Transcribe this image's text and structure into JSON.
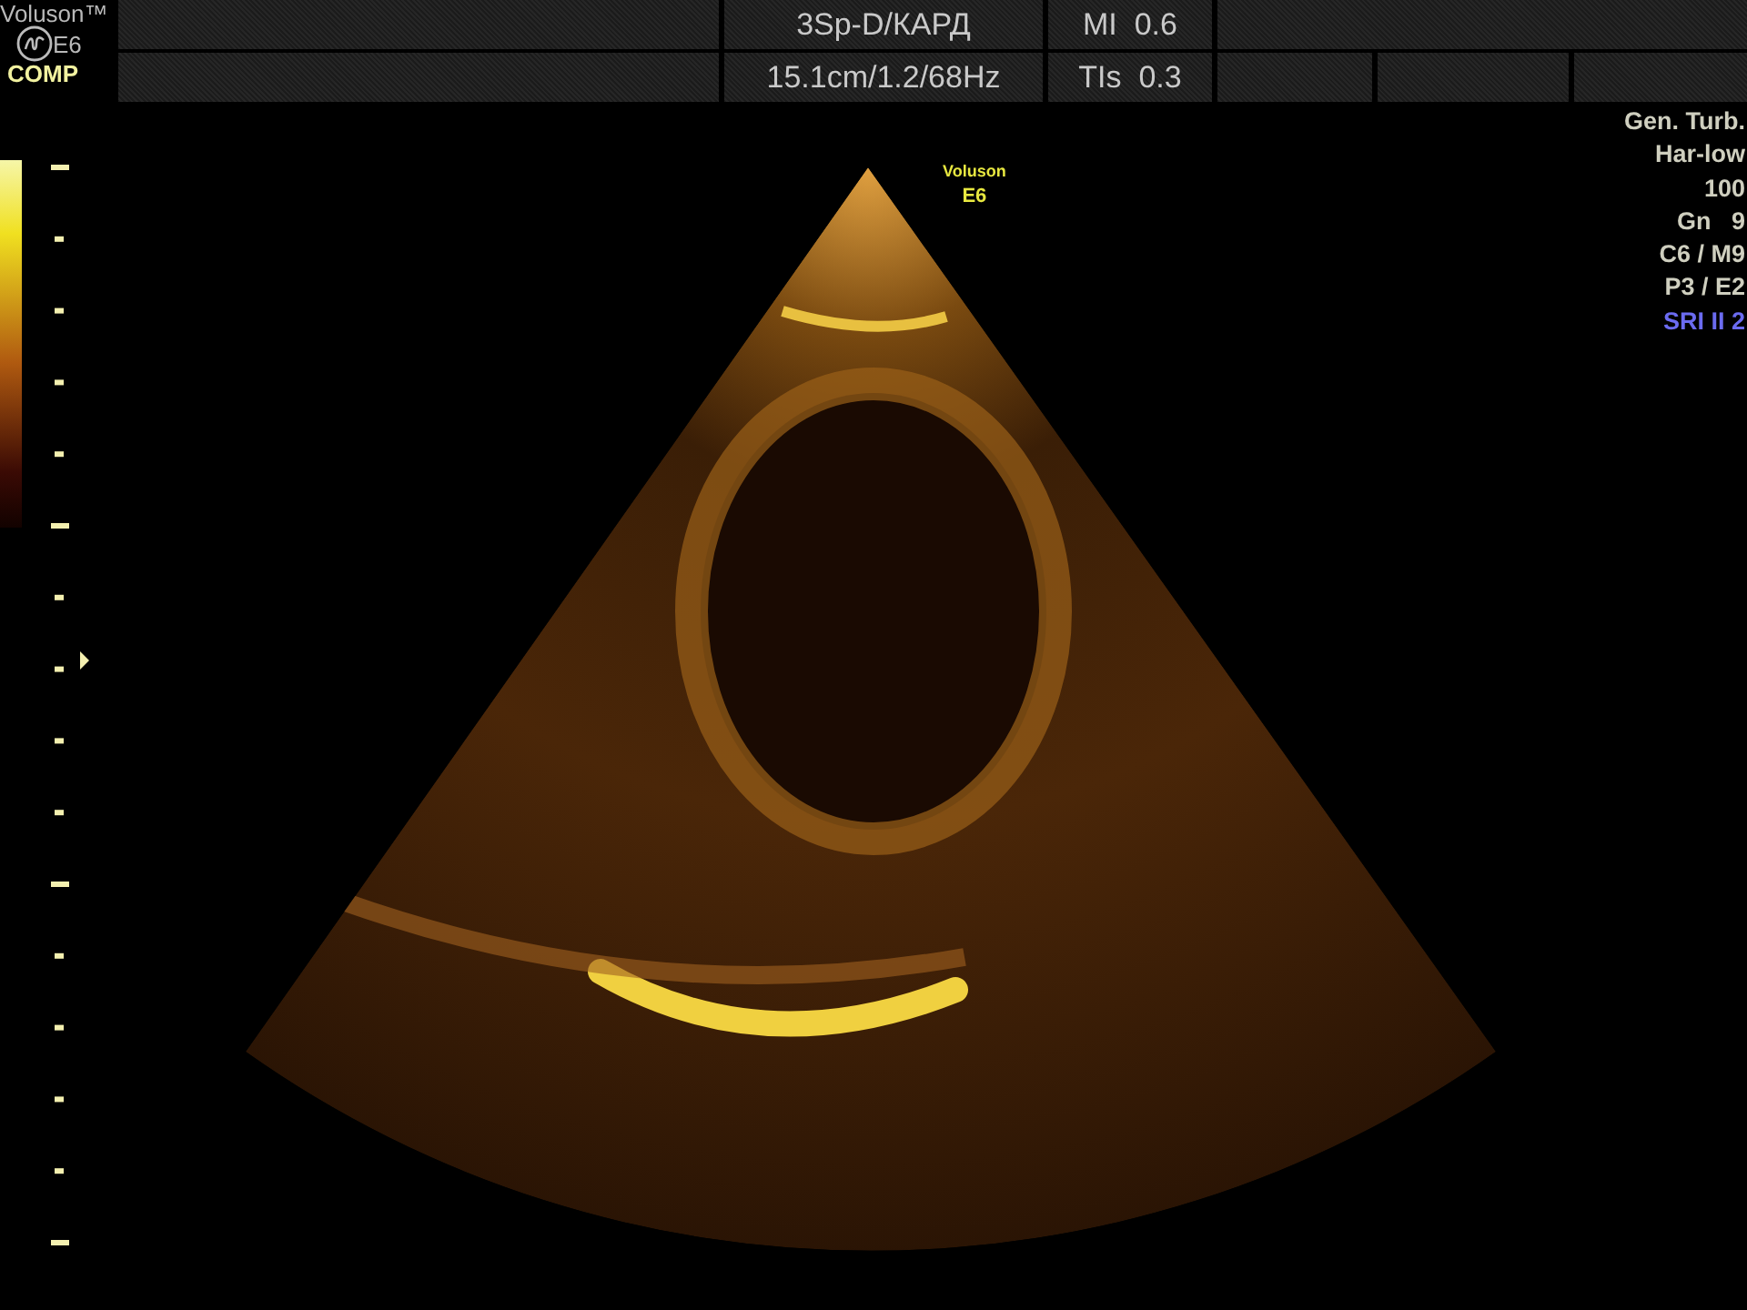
{
  "brand": {
    "title": "Voluson™",
    "model": "E6",
    "preset": "COMP"
  },
  "header": {
    "probe_mode": "3Sp-D/КАРД",
    "depth_info": "15.1cm/1.2/68Hz",
    "mi": "MI  0.6",
    "tis": "TIs  0.3"
  },
  "image_label": {
    "line1": "Voluson",
    "line2": "E6"
  },
  "parameters": [
    {
      "text": "Gen. Turb.",
      "kind": "normal"
    },
    {
      "text": "Har-low",
      "kind": "normal"
    },
    {
      "text": "100",
      "kind": "normal"
    },
    {
      "text": "Gn   9",
      "kind": "normal"
    },
    {
      "text": "C6 / M9",
      "kind": "normal"
    },
    {
      "text": "P3 / E2",
      "kind": "normal"
    },
    {
      "text": "SRI II 2",
      "kind": "highlight"
    }
  ]
}
